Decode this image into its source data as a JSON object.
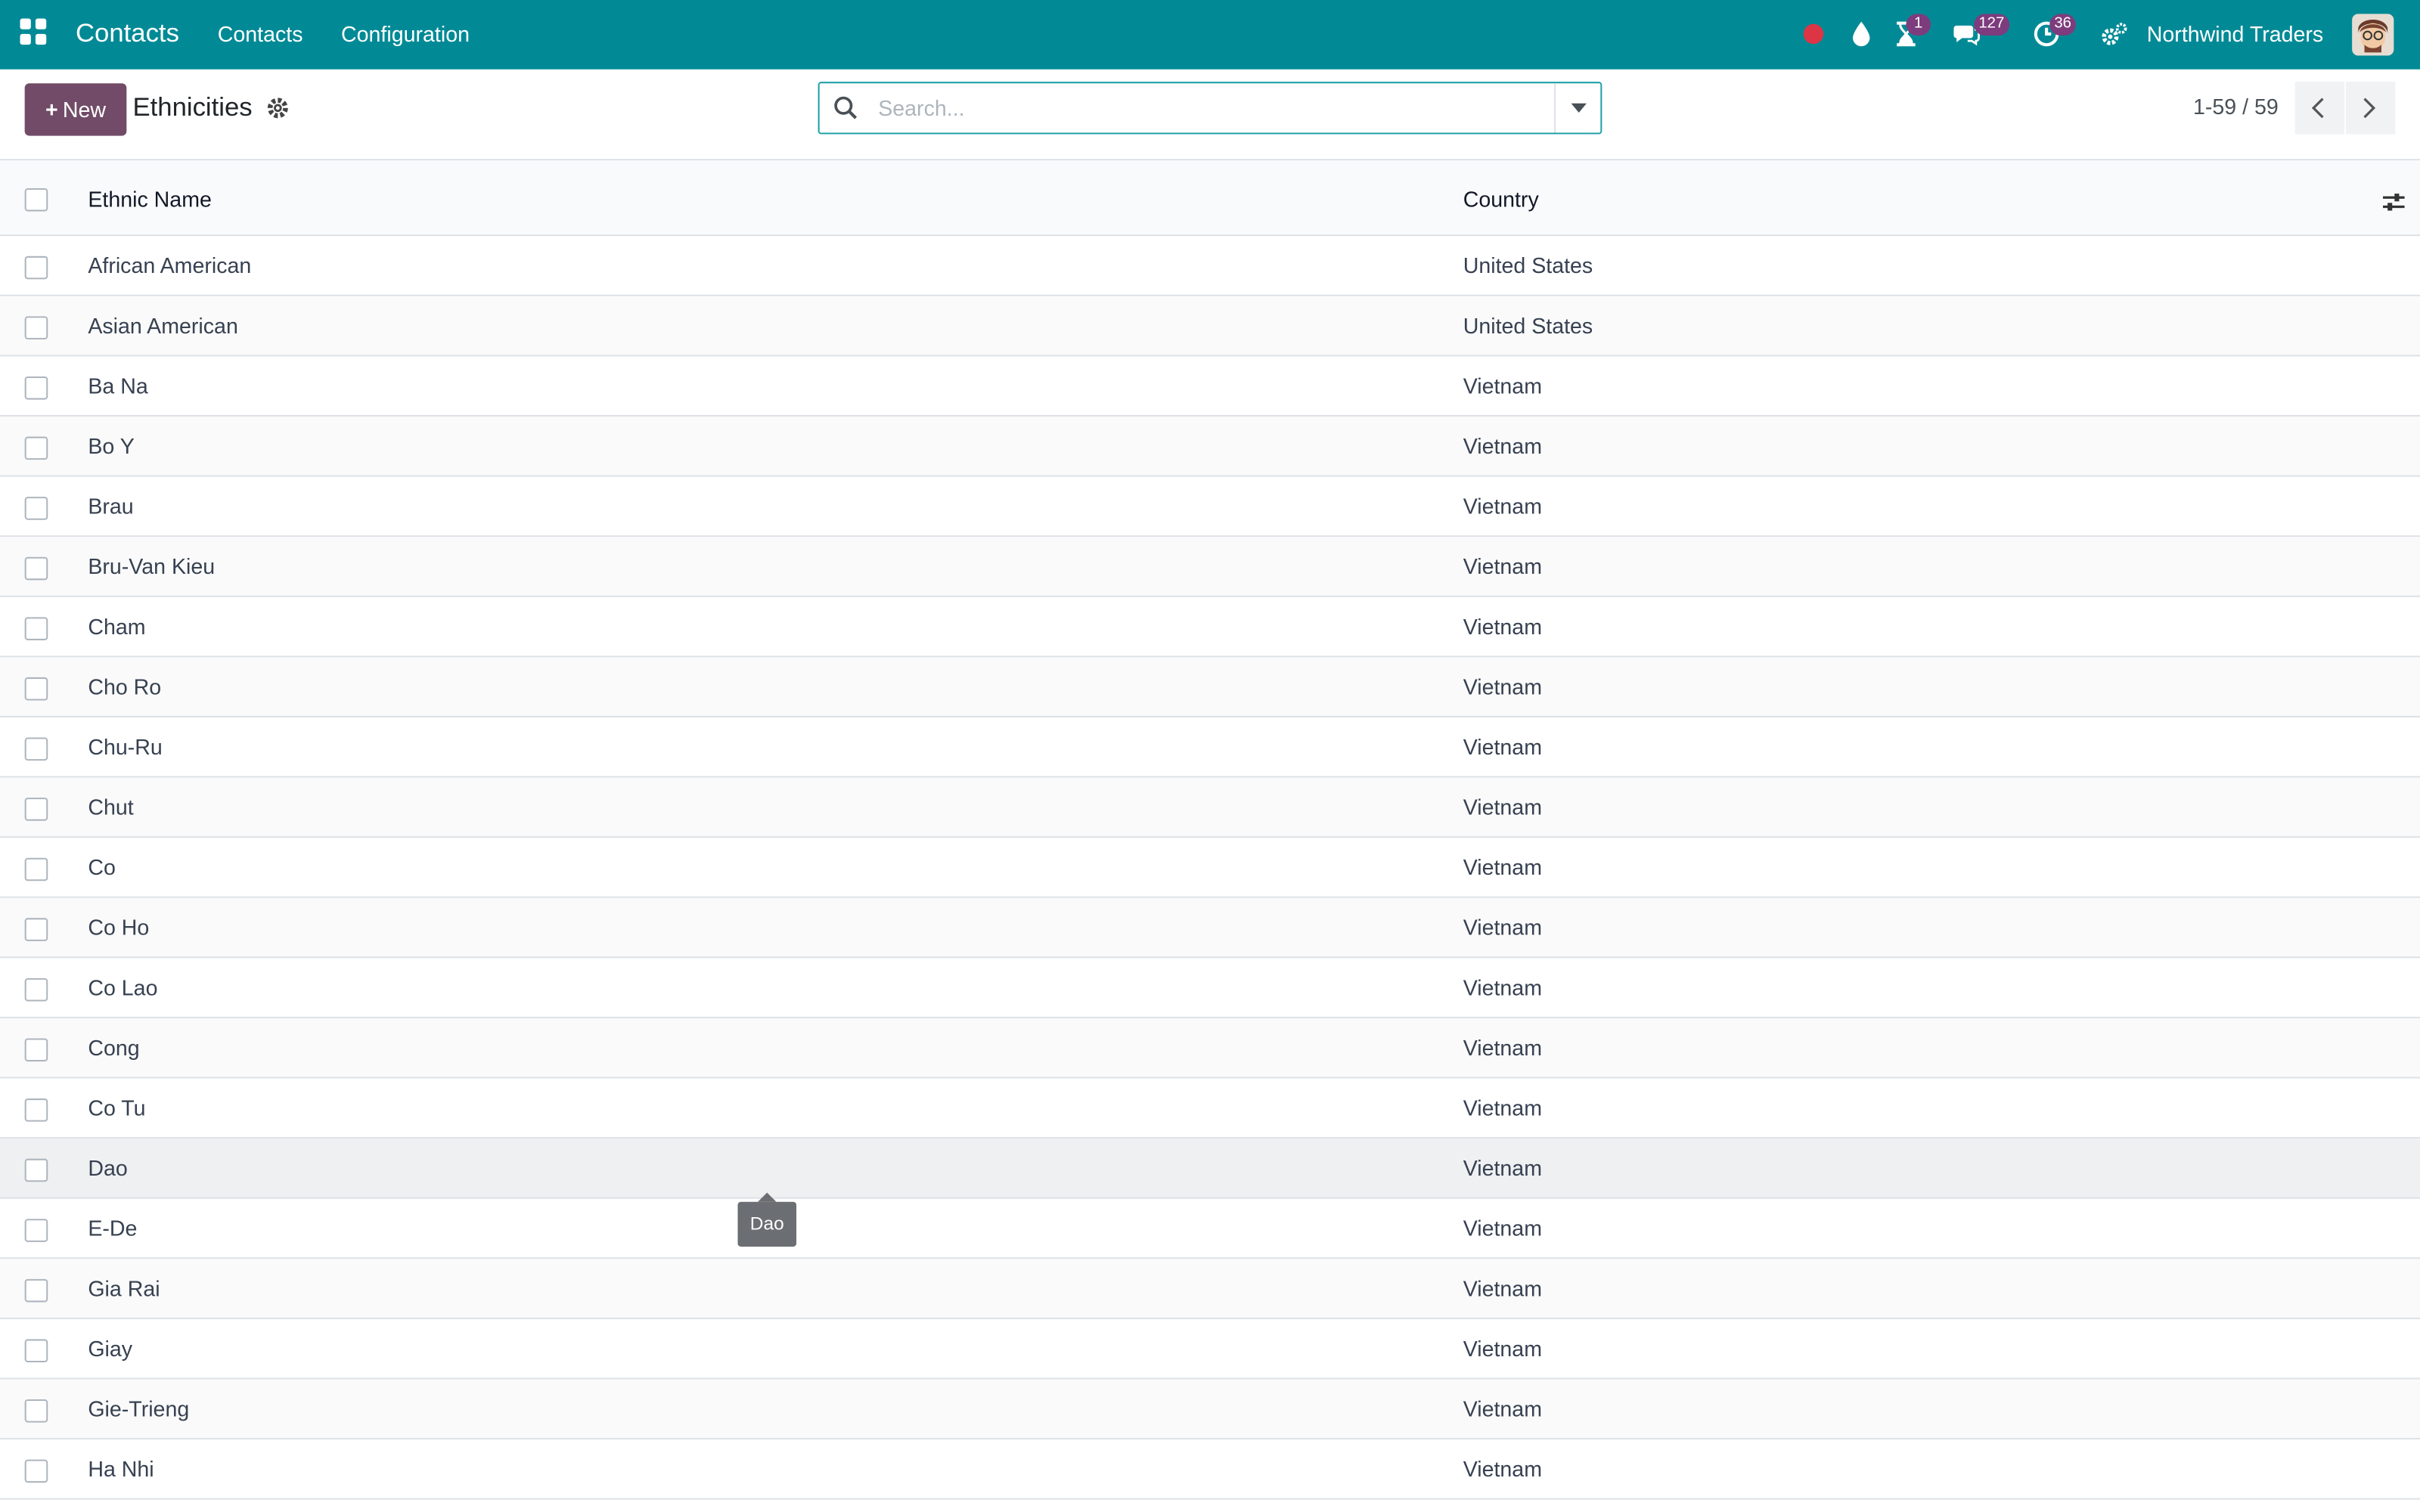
{
  "navbar": {
    "app_name": "Contacts",
    "menu": [
      "Contacts",
      "Configuration"
    ],
    "badges": {
      "activities": "1",
      "messages": "127",
      "clock": "36"
    },
    "company": "Northwind Traders",
    "colors": {
      "navbar": "#018a96",
      "badge": "#7d3c7d",
      "record_dot": "#dc3545"
    }
  },
  "control": {
    "new_label": "New",
    "title": "Ethnicities",
    "search_placeholder": "Search...",
    "pager": "1-59 / 59"
  },
  "table": {
    "columns": [
      "Ethnic Name",
      "Country"
    ],
    "rows": [
      {
        "name": "African American",
        "country": "United States"
      },
      {
        "name": "Asian American",
        "country": "United States"
      },
      {
        "name": "Ba Na",
        "country": "Vietnam"
      },
      {
        "name": "Bo Y",
        "country": "Vietnam"
      },
      {
        "name": "Brau",
        "country": "Vietnam"
      },
      {
        "name": "Bru-Van Kieu",
        "country": "Vietnam"
      },
      {
        "name": "Cham",
        "country": "Vietnam"
      },
      {
        "name": "Cho Ro",
        "country": "Vietnam"
      },
      {
        "name": "Chu-Ru",
        "country": "Vietnam"
      },
      {
        "name": "Chut",
        "country": "Vietnam"
      },
      {
        "name": "Co",
        "country": "Vietnam"
      },
      {
        "name": "Co Ho",
        "country": "Vietnam"
      },
      {
        "name": "Co Lao",
        "country": "Vietnam"
      },
      {
        "name": "Cong",
        "country": "Vietnam"
      },
      {
        "name": "Co Tu",
        "country": "Vietnam"
      },
      {
        "name": "Dao",
        "country": "Vietnam"
      },
      {
        "name": "E-De",
        "country": "Vietnam"
      },
      {
        "name": "Gia Rai",
        "country": "Vietnam"
      },
      {
        "name": "Giay",
        "country": "Vietnam"
      },
      {
        "name": "Gie-Trieng",
        "country": "Vietnam"
      },
      {
        "name": "Ha Nhi",
        "country": "Vietnam"
      }
    ]
  },
  "tooltip": {
    "text": "Dao"
  }
}
